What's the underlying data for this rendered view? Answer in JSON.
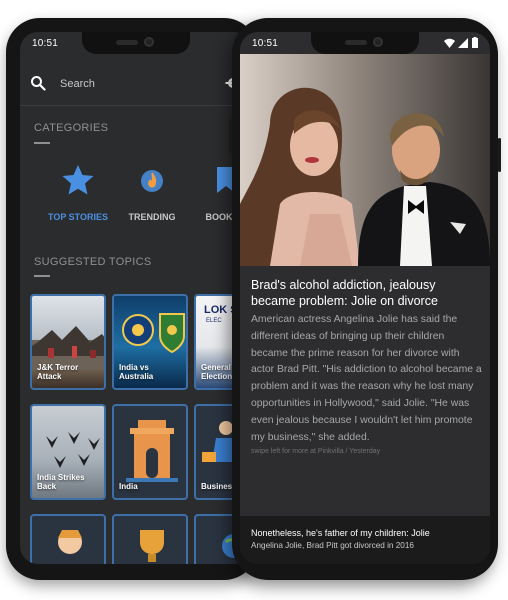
{
  "back_phone": {
    "time": "10:51",
    "search_placeholder": "Search",
    "categories_title": "CATEGORIES",
    "categories": [
      {
        "label": "TOP STORIES",
        "icon": "star-icon",
        "active": true
      },
      {
        "label": "TRENDING",
        "icon": "flame-icon",
        "active": false
      },
      {
        "label": "BOOKMA",
        "icon": "bookmark-icon",
        "active": false
      }
    ],
    "suggested_title": "SUGGESTED TOPICS",
    "topics": [
      {
        "label": "J&K Terror Attack"
      },
      {
        "label": "India vs Australia"
      },
      {
        "label": "General Election"
      },
      {
        "label": "India Strikes Back"
      },
      {
        "label": "India"
      },
      {
        "label": "Busines"
      }
    ],
    "tile_text": {
      "lok": "LOK S",
      "elec": "ELEC"
    }
  },
  "front_phone": {
    "time": "10:51",
    "headline": "Brad's alcohol addiction, jealousy became problem: Jolie on divorce",
    "body": "American actress Angelina Jolie has said the different ideas of bringing up their children became the prime reason for her divorce with actor Brad Pitt. \"His addiction to alcohol became a problem and it was the reason why he lost many opportunities in Hollywood,\" said Jolie. \"He was even jealous because I wouldn't let him promote my business,\" she added.",
    "credit": "swipe left for more at Pinkvilla / Yesterday",
    "footer_title": "Nonetheless, he's father of my children: Jolie",
    "footer_subtitle": "Angelina Jolie, Brad Pitt got divorced in 2016"
  },
  "colors": {
    "accent": "#4a90e2",
    "screen_bg": "#2b2c2e",
    "tile_border": "#3d6fa8"
  }
}
